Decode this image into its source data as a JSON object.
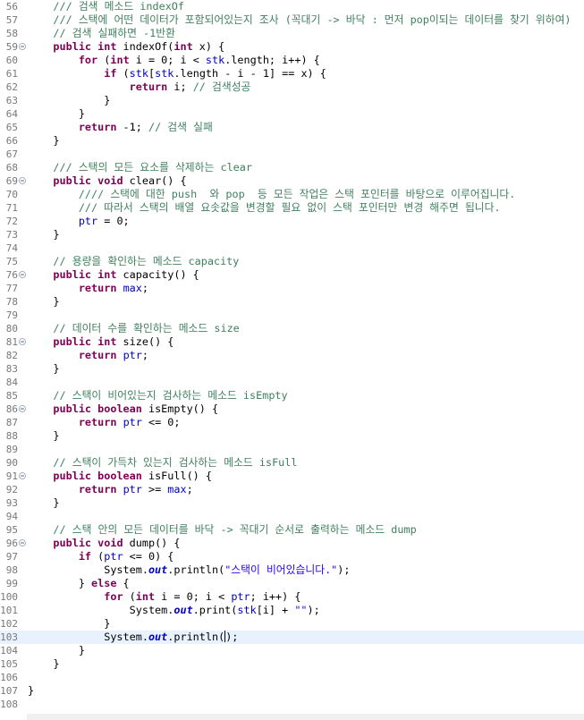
{
  "editor": {
    "fold_icon": "fold-minus-icon",
    "colors": {
      "keyword": "#7f0055",
      "comment": "#3f7f5f",
      "string": "#2a00ff",
      "field": "#0000c0",
      "current_line": "#e8f2fe",
      "line_number": "#787878"
    },
    "current_line": 103,
    "lines": [
      {
        "n": "56",
        "fold": false,
        "t": [
          [
            "cm",
            "    /// 검색 메소드 indexOf"
          ]
        ]
      },
      {
        "n": "57",
        "fold": false,
        "t": [
          [
            "cm",
            "    /// 스택에 어떤 데이터가 포함되어있는지 조사 (꼭대기 -> 바닥 : 먼저 pop이되는 데이터를 찾기 위하여)"
          ]
        ]
      },
      {
        "n": "58",
        "fold": false,
        "t": [
          [
            "cm",
            "    // 검색 실패하면 -1반환"
          ]
        ]
      },
      {
        "n": "59",
        "fold": true,
        "t": [
          [
            "",
            "    "
          ],
          [
            "kw",
            "public int"
          ],
          [
            "",
            " indexOf("
          ],
          [
            "kw",
            "int"
          ],
          [
            "",
            " x) {"
          ]
        ]
      },
      {
        "n": "60",
        "fold": false,
        "t": [
          [
            "",
            "        "
          ],
          [
            "kw",
            "for"
          ],
          [
            "",
            " ("
          ],
          [
            "kw",
            "int"
          ],
          [
            "",
            " i = 0; i < "
          ],
          [
            "fld",
            "stk"
          ],
          [
            "",
            ".length; i++) {"
          ]
        ]
      },
      {
        "n": "61",
        "fold": false,
        "t": [
          [
            "",
            "            "
          ],
          [
            "kw",
            "if"
          ],
          [
            "",
            " ("
          ],
          [
            "fld",
            "stk"
          ],
          [
            "",
            "["
          ],
          [
            "fld",
            "stk"
          ],
          [
            "",
            ".length - i - 1] == x) {"
          ]
        ]
      },
      {
        "n": "62",
        "fold": false,
        "t": [
          [
            "",
            "                "
          ],
          [
            "kw",
            "return"
          ],
          [
            "",
            " i; "
          ],
          [
            "cm",
            "// 검색성공"
          ]
        ]
      },
      {
        "n": "63",
        "fold": false,
        "t": [
          [
            "",
            "            }"
          ]
        ]
      },
      {
        "n": "64",
        "fold": false,
        "t": [
          [
            "",
            "        }"
          ]
        ]
      },
      {
        "n": "65",
        "fold": false,
        "t": [
          [
            "",
            "        "
          ],
          [
            "kw",
            "return"
          ],
          [
            "",
            " -1; "
          ],
          [
            "cm",
            "// 검색 실패"
          ]
        ]
      },
      {
        "n": "66",
        "fold": false,
        "t": [
          [
            "",
            "    }"
          ]
        ]
      },
      {
        "n": "67",
        "fold": false,
        "t": []
      },
      {
        "n": "68",
        "fold": false,
        "t": [
          [
            "cm",
            "    /// 스택의 모든 요소를 삭제하는 clear"
          ]
        ]
      },
      {
        "n": "69",
        "fold": true,
        "t": [
          [
            "",
            "    "
          ],
          [
            "kw",
            "public void"
          ],
          [
            "",
            " clear() {"
          ]
        ]
      },
      {
        "n": "70",
        "fold": false,
        "t": [
          [
            "cm",
            "        //// 스택에 대한 push  와 pop  등 모든 작업은 스택 포인터를 바탕으로 이루어집니다."
          ]
        ]
      },
      {
        "n": "71",
        "fold": false,
        "t": [
          [
            "cm",
            "        /// 따라서 스택의 배열 요솟값을 변경할 필요 없이 스택 포인터만 변경 해주면 됩니다."
          ]
        ]
      },
      {
        "n": "72",
        "fold": false,
        "t": [
          [
            "",
            "        "
          ],
          [
            "fld",
            "ptr"
          ],
          [
            "",
            " = 0;"
          ]
        ]
      },
      {
        "n": "73",
        "fold": false,
        "t": [
          [
            "",
            "    }"
          ]
        ]
      },
      {
        "n": "74",
        "fold": false,
        "t": []
      },
      {
        "n": "75",
        "fold": false,
        "t": [
          [
            "cm",
            "    // 용량을 확인하는 메소드 capacity"
          ]
        ]
      },
      {
        "n": "76",
        "fold": true,
        "t": [
          [
            "",
            "    "
          ],
          [
            "kw",
            "public int"
          ],
          [
            "",
            " capacity() {"
          ]
        ]
      },
      {
        "n": "77",
        "fold": false,
        "t": [
          [
            "",
            "        "
          ],
          [
            "kw",
            "return"
          ],
          [
            "",
            " "
          ],
          [
            "fld",
            "max"
          ],
          [
            "",
            ";"
          ]
        ]
      },
      {
        "n": "78",
        "fold": false,
        "t": [
          [
            "",
            "    }"
          ]
        ]
      },
      {
        "n": "79",
        "fold": false,
        "t": []
      },
      {
        "n": "80",
        "fold": false,
        "t": [
          [
            "cm",
            "    // 데이터 수를 확인하는 메소드 size"
          ]
        ]
      },
      {
        "n": "81",
        "fold": true,
        "t": [
          [
            "",
            "    "
          ],
          [
            "kw",
            "public int"
          ],
          [
            "",
            " size() {"
          ]
        ]
      },
      {
        "n": "82",
        "fold": false,
        "t": [
          [
            "",
            "        "
          ],
          [
            "kw",
            "return"
          ],
          [
            "",
            " "
          ],
          [
            "fld",
            "ptr"
          ],
          [
            "",
            ";"
          ]
        ]
      },
      {
        "n": "83",
        "fold": false,
        "t": [
          [
            "",
            "    }"
          ]
        ]
      },
      {
        "n": "84",
        "fold": false,
        "t": []
      },
      {
        "n": "85",
        "fold": false,
        "t": [
          [
            "cm",
            "    // 스택이 비어있는지 검사하는 메소드 isEmpty"
          ]
        ]
      },
      {
        "n": "86",
        "fold": true,
        "t": [
          [
            "",
            "    "
          ],
          [
            "kw",
            "public boolean"
          ],
          [
            "",
            " isEmpty() {"
          ]
        ]
      },
      {
        "n": "87",
        "fold": false,
        "t": [
          [
            "",
            "        "
          ],
          [
            "kw",
            "return"
          ],
          [
            "",
            " "
          ],
          [
            "fld",
            "ptr"
          ],
          [
            "",
            " <= 0;"
          ]
        ]
      },
      {
        "n": "88",
        "fold": false,
        "t": [
          [
            "",
            "    }"
          ]
        ]
      },
      {
        "n": "89",
        "fold": false,
        "t": []
      },
      {
        "n": "90",
        "fold": false,
        "t": [
          [
            "cm",
            "    // 스택이 가득차 있는지 검사하는 메소드 isFull"
          ]
        ]
      },
      {
        "n": "91",
        "fold": true,
        "t": [
          [
            "",
            "    "
          ],
          [
            "kw",
            "public boolean"
          ],
          [
            "",
            " isFull() {"
          ]
        ]
      },
      {
        "n": "92",
        "fold": false,
        "t": [
          [
            "",
            "        "
          ],
          [
            "kw",
            "return"
          ],
          [
            "",
            " "
          ],
          [
            "fld",
            "ptr"
          ],
          [
            "",
            " >= "
          ],
          [
            "fld",
            "max"
          ],
          [
            "",
            ";"
          ]
        ]
      },
      {
        "n": "93",
        "fold": false,
        "t": [
          [
            "",
            "    }"
          ]
        ]
      },
      {
        "n": "94",
        "fold": false,
        "t": []
      },
      {
        "n": "95",
        "fold": false,
        "t": [
          [
            "cm",
            "    // 스택 안의 모든 데이터를 바닥 -> 꼭대기 순서로 출력하는 메소드 dump"
          ]
        ]
      },
      {
        "n": "96",
        "fold": true,
        "t": [
          [
            "",
            "    "
          ],
          [
            "kw",
            "public void"
          ],
          [
            "",
            " dump() {"
          ]
        ]
      },
      {
        "n": "97",
        "fold": false,
        "t": [
          [
            "",
            "        "
          ],
          [
            "kw",
            "if"
          ],
          [
            "",
            " ("
          ],
          [
            "fld",
            "ptr"
          ],
          [
            "",
            " <= 0) {"
          ]
        ]
      },
      {
        "n": "98",
        "fold": false,
        "t": [
          [
            "",
            "            System."
          ],
          [
            "sfld",
            "out"
          ],
          [
            "",
            ".println("
          ],
          [
            "str",
            "\"스택이 비어있습니다.\""
          ],
          [
            "",
            ");"
          ]
        ]
      },
      {
        "n": "99",
        "fold": false,
        "t": [
          [
            "",
            "        } "
          ],
          [
            "kw",
            "else"
          ],
          [
            "",
            " {"
          ]
        ]
      },
      {
        "n": "100",
        "fold": false,
        "t": [
          [
            "",
            "            "
          ],
          [
            "kw",
            "for"
          ],
          [
            "",
            " ("
          ],
          [
            "kw",
            "int"
          ],
          [
            "",
            " i = 0; i < "
          ],
          [
            "fld",
            "ptr"
          ],
          [
            "",
            "; i++) {"
          ]
        ]
      },
      {
        "n": "101",
        "fold": false,
        "t": [
          [
            "",
            "                System."
          ],
          [
            "sfld",
            "out"
          ],
          [
            "",
            ".print("
          ],
          [
            "fld",
            "stk"
          ],
          [
            "",
            "[i] + "
          ],
          [
            "str",
            "\"\""
          ],
          [
            "",
            ");"
          ]
        ]
      },
      {
        "n": "102",
        "fold": false,
        "t": [
          [
            "",
            "            }"
          ]
        ]
      },
      {
        "n": "103",
        "fold": false,
        "t": [
          [
            "",
            "            System."
          ],
          [
            "sfld",
            "out"
          ],
          [
            "",
            ".println("
          ],
          [
            "caret",
            ""
          ],
          [
            "",
            ");"
          ]
        ]
      },
      {
        "n": "104",
        "fold": false,
        "t": [
          [
            "",
            "        }"
          ]
        ]
      },
      {
        "n": "105",
        "fold": false,
        "t": [
          [
            "",
            "    }"
          ]
        ]
      },
      {
        "n": "106",
        "fold": false,
        "t": []
      },
      {
        "n": "107",
        "fold": false,
        "t": [
          [
            "",
            "}"
          ]
        ]
      },
      {
        "n": "108",
        "fold": false,
        "t": []
      }
    ]
  }
}
